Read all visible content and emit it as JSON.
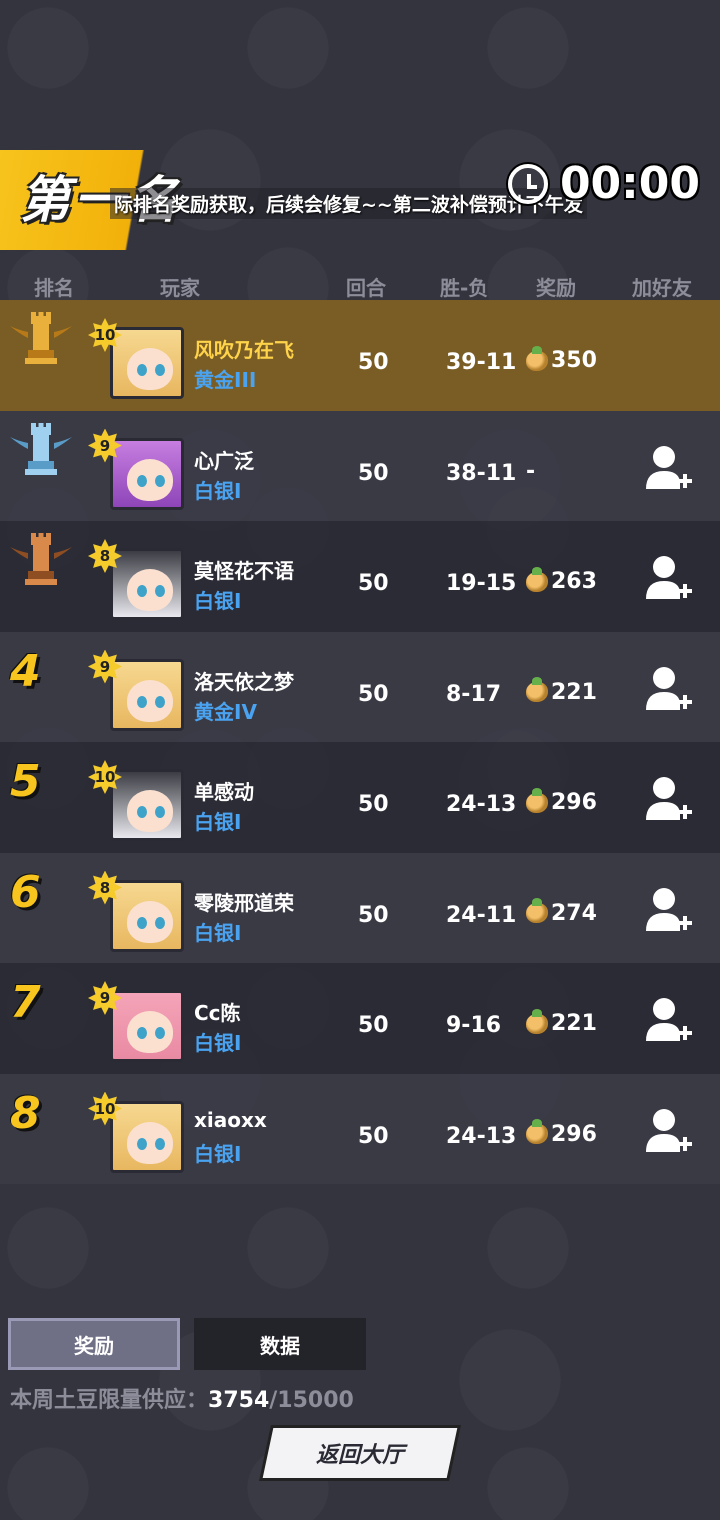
{
  "header": {
    "rank_title": "第一名",
    "notice": "际排名奖励获取，后续会修复~~第二波补偿预计下午发",
    "timer": "00:00"
  },
  "columns": {
    "rank": "排名",
    "player": "玩家",
    "rounds": "回合",
    "winloss": "胜-负",
    "reward": "奖励",
    "add_friend": "加好友"
  },
  "rows": [
    {
      "rank": "1",
      "trophy": "gold-trophy-icon",
      "level": "10",
      "name": "风吹乃在飞",
      "tier": "黄金III",
      "rounds": "50",
      "winloss": "39-11",
      "reward": "350",
      "avatar": "blonde"
    },
    {
      "rank": "2",
      "trophy": "silver-trophy-icon",
      "level": "9",
      "name": "心广泛",
      "tier": "白银I",
      "rounds": "50",
      "winloss": "38-11",
      "reward": "-",
      "avatar": "purple"
    },
    {
      "rank": "3",
      "trophy": "bronze-trophy-icon",
      "level": "8",
      "name": "莫怪花不语",
      "tier": "白银I",
      "rounds": "50",
      "winloss": "19-15",
      "reward": "263",
      "avatar": "dark"
    },
    {
      "rank": "4",
      "level": "9",
      "name": "洛天依之梦",
      "tier": "黄金IV",
      "rounds": "50",
      "winloss": "8-17",
      "reward": "221",
      "avatar": "blonde"
    },
    {
      "rank": "5",
      "level": "10",
      "name": "单感动",
      "tier": "白银I",
      "rounds": "50",
      "winloss": "24-13",
      "reward": "296",
      "avatar": "dark"
    },
    {
      "rank": "6",
      "level": "8",
      "name": "零陵邢道荣",
      "tier": "白银I",
      "rounds": "50",
      "winloss": "24-11",
      "reward": "274",
      "avatar": "blonde"
    },
    {
      "rank": "7",
      "level": "9",
      "name": "Cc陈",
      "tier": "白银I",
      "rounds": "50",
      "winloss": "9-16",
      "reward": "221",
      "avatar": "pink"
    },
    {
      "rank": "8",
      "level": "10",
      "name": "xiaoxx",
      "tier": "白银I",
      "rounds": "50",
      "winloss": "24-13",
      "reward": "296",
      "avatar": "blonde"
    }
  ],
  "tabs": {
    "rewards": "奖励",
    "data": "数据"
  },
  "supply": {
    "label": "本周土豆限量供应：",
    "current": "3754",
    "separator": "/",
    "max": "15000"
  },
  "back_button": "返回大厅",
  "colors": {
    "first_row": "#7a5d24",
    "accent": "#f7c51e",
    "tier_blue": "#4aa3f0"
  }
}
